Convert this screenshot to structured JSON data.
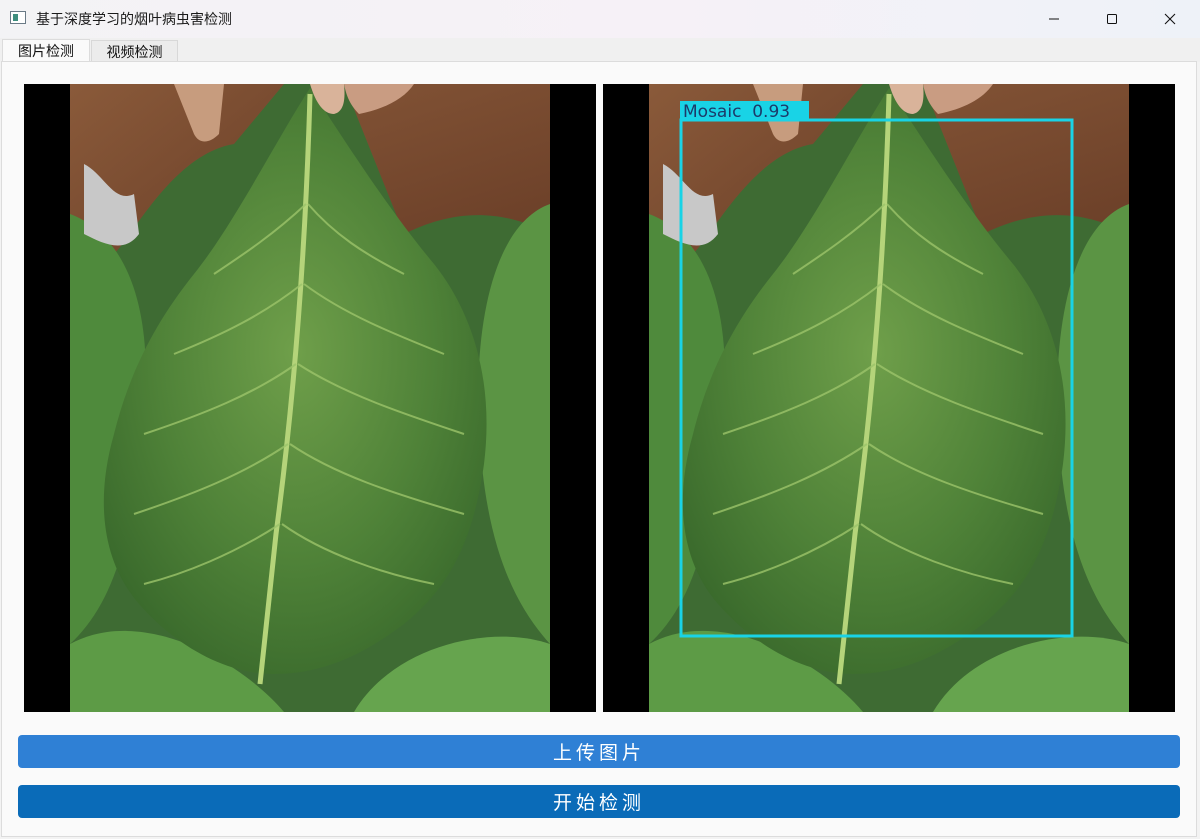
{
  "window": {
    "title": "基于深度学习的烟叶病虫害检测"
  },
  "tabs": [
    {
      "label": "图片检测",
      "active": true
    },
    {
      "label": "视频检测",
      "active": false
    }
  ],
  "original_image": {
    "description_icon": "leaf-photo"
  },
  "result_image": {
    "detection_label": "Mosaic  0.93",
    "box_color": "#19d3e6"
  },
  "buttons": {
    "upload_label": "上传图片",
    "detect_label": "开始检测"
  },
  "colors": {
    "upload_button": "#2f80d5",
    "detect_button": "#0a6bb8"
  }
}
